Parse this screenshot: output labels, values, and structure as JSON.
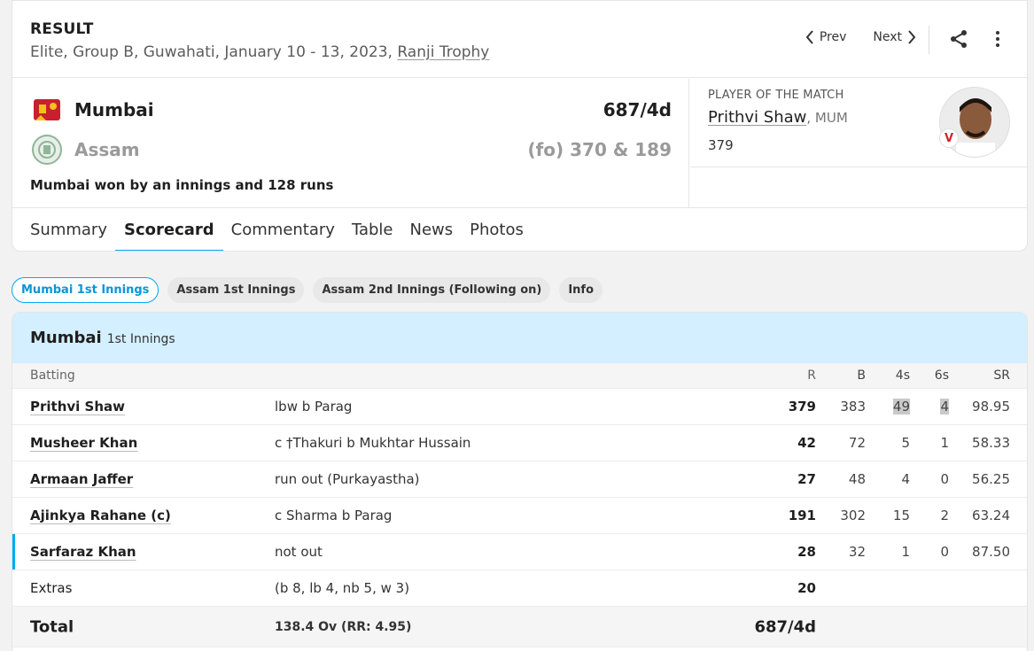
{
  "header": {
    "status": "RESULT",
    "match_meta": "Elite, Group B, Guwahati, January 10 - 13, 2023,",
    "series_link": "Ranji Trophy",
    "prev_label": "Prev",
    "next_label": "Next"
  },
  "teams": [
    {
      "name": "Mumbai",
      "score": "687/4d"
    },
    {
      "name": "Assam",
      "score": "(fo) 370 & 189"
    }
  ],
  "result_text": "Mumbai won by an innings and 128 runs",
  "player_of_match": {
    "label": "PLAYER OF THE MATCH",
    "name": "Prithvi Shaw",
    "team": ", MUM",
    "stat": "379"
  },
  "tabs": [
    "Summary",
    "Scorecard",
    "Commentary",
    "Table",
    "News",
    "Photos"
  ],
  "innings_pills": [
    "Mumbai 1st Innings",
    "Assam 1st Innings",
    "Assam 2nd Innings (Following on)",
    "Info"
  ],
  "innings": {
    "team": "Mumbai",
    "label": "1st Innings",
    "columns": {
      "batting": "Batting",
      "r": "R",
      "b": "B",
      "fours": "4s",
      "sixes": "6s",
      "sr": "SR"
    },
    "batters": [
      {
        "name": "Prithvi Shaw",
        "dismissal": "lbw b Parag",
        "r": "379",
        "b": "383",
        "fours": "49",
        "sixes": "4",
        "sr": "98.95"
      },
      {
        "name": "Musheer Khan",
        "dismissal": "c †Thakuri b Mukhtar Hussain",
        "r": "42",
        "b": "72",
        "fours": "5",
        "sixes": "1",
        "sr": "58.33"
      },
      {
        "name": "Armaan Jaffer",
        "dismissal": "run out (Purkayastha)",
        "r": "27",
        "b": "48",
        "fours": "4",
        "sixes": "0",
        "sr": "56.25"
      },
      {
        "name": "Ajinkya Rahane (c)",
        "dismissal": "c Sharma b Parag",
        "r": "191",
        "b": "302",
        "fours": "15",
        "sixes": "2",
        "sr": "63.24"
      },
      {
        "name": "Sarfaraz Khan",
        "dismissal": "not out",
        "r": "28",
        "b": "32",
        "fours": "1",
        "sixes": "0",
        "sr": "87.50"
      }
    ],
    "extras": {
      "label": "Extras",
      "detail": "(b 8, lb 4, nb 5, w 3)",
      "value": "20"
    },
    "total": {
      "label": "Total",
      "detail": "138.4 Ov (RR: 4.95)",
      "value": "687/4d"
    }
  },
  "colors": {
    "accent": "#03a9f4",
    "innings_header_bg": "#d4efff"
  }
}
